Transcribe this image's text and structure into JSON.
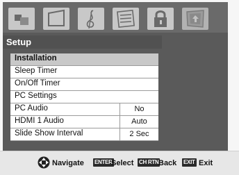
{
  "menu_tabs": [
    {
      "icon": "picture-icon",
      "active": false
    },
    {
      "icon": "screen-icon",
      "active": false
    },
    {
      "icon": "audio-icon",
      "active": false
    },
    {
      "icon": "preferences-icon",
      "active": false
    },
    {
      "icon": "lock-icon",
      "active": false
    },
    {
      "icon": "setup-icon",
      "active": true
    }
  ],
  "panel": {
    "title": "Setup"
  },
  "menu_items": [
    {
      "label": "Installation",
      "value": null,
      "selected": true
    },
    {
      "label": "Sleep Timer",
      "value": null,
      "selected": false
    },
    {
      "label": "On/Off Timer",
      "value": null,
      "selected": false
    },
    {
      "label": "PC Settings",
      "value": null,
      "selected": false
    },
    {
      "label": "PC Audio",
      "value": "No",
      "selected": false
    },
    {
      "label": "HDMI 1 Audio",
      "value": "Auto",
      "selected": false
    },
    {
      "label": "Slide Show Interval",
      "value": "2 Sec",
      "selected": false
    }
  ],
  "footer": {
    "navigate_label": "Navigate",
    "enter_key": "ENTER",
    "select_label": "Select",
    "back_key": "CH RTN",
    "back_label": "Back",
    "exit_key": "EXIT",
    "exit_label": "Exit"
  },
  "colors": {
    "panel_bg": "#5a5a5a",
    "row_selected": "#c8c8c8",
    "row_bg": "#ffffff"
  }
}
